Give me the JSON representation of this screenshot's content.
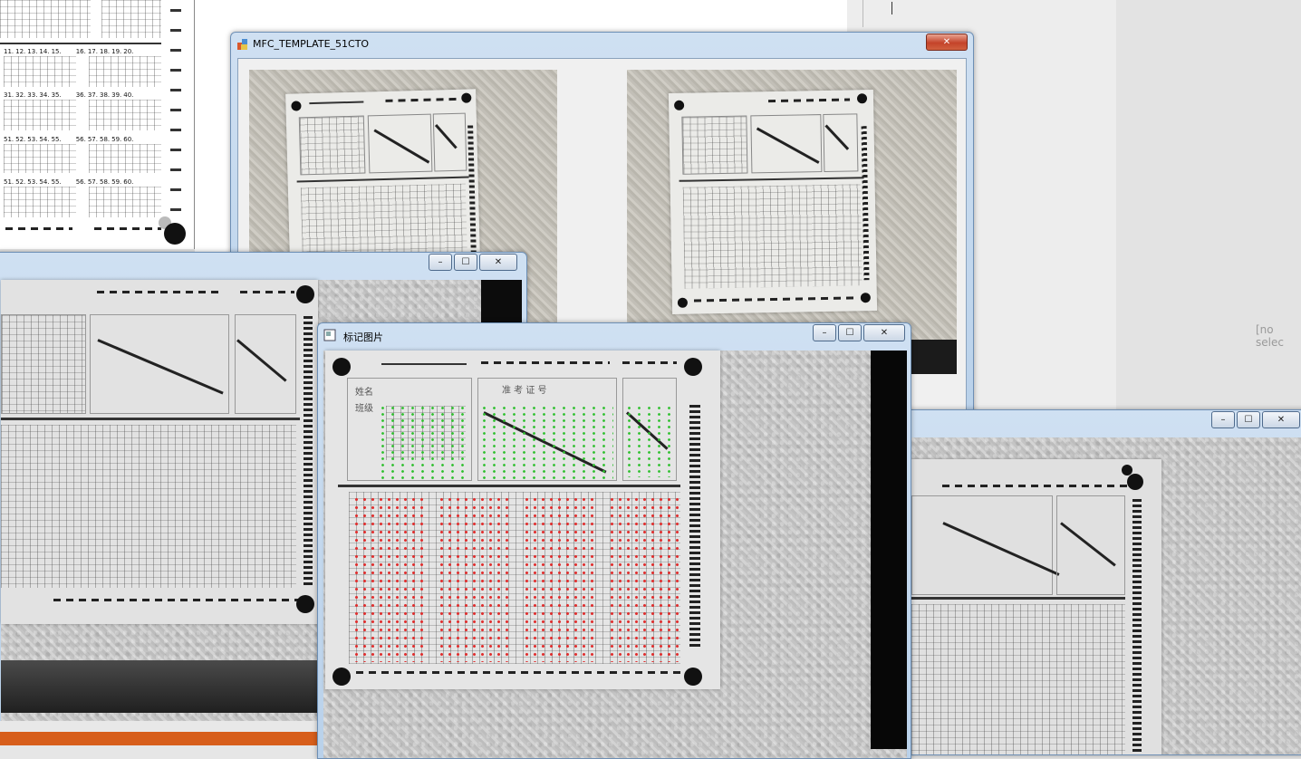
{
  "main_window": {
    "title": "MFC_TEMPLATE_51CTO",
    "close_label": "✕"
  },
  "left_window": {
    "minimize_label": "–",
    "maximize_label": "☐",
    "close_label": "✕"
  },
  "mark_window": {
    "title": "标记图片",
    "minimize_label": "–",
    "maximize_label": "☐",
    "close_label": "✕"
  },
  "right_window": {
    "minimize_label": "–",
    "maximize_label": "☐",
    "close_label": "✕"
  },
  "template_sheet": {
    "rows": [
      [
        "11.",
        "12.",
        "13.",
        "14.",
        "15.",
        "16.",
        "17.",
        "18.",
        "19.",
        "20."
      ],
      [
        "31.",
        "32.",
        "33.",
        "34.",
        "35.",
        "36.",
        "37.",
        "38.",
        "39.",
        "40."
      ],
      [
        "51.",
        "52.",
        "53.",
        "54.",
        "55.",
        "56.",
        "57.",
        "58.",
        "59.",
        "60."
      ],
      [
        "51.",
        "52.",
        "53.",
        "54.",
        "55.",
        "56.",
        "57.",
        "58.",
        "59.",
        "60."
      ]
    ]
  },
  "right_panel": {
    "placeholder": "[no selec"
  },
  "sheet_labels": {
    "name": "姓名",
    "class": "班级",
    "exam_id": "准 考 证 号"
  },
  "colors": {
    "accent_orange": "#d75e1b",
    "green_marks": "#30c030",
    "red_marks": "#e03030"
  }
}
